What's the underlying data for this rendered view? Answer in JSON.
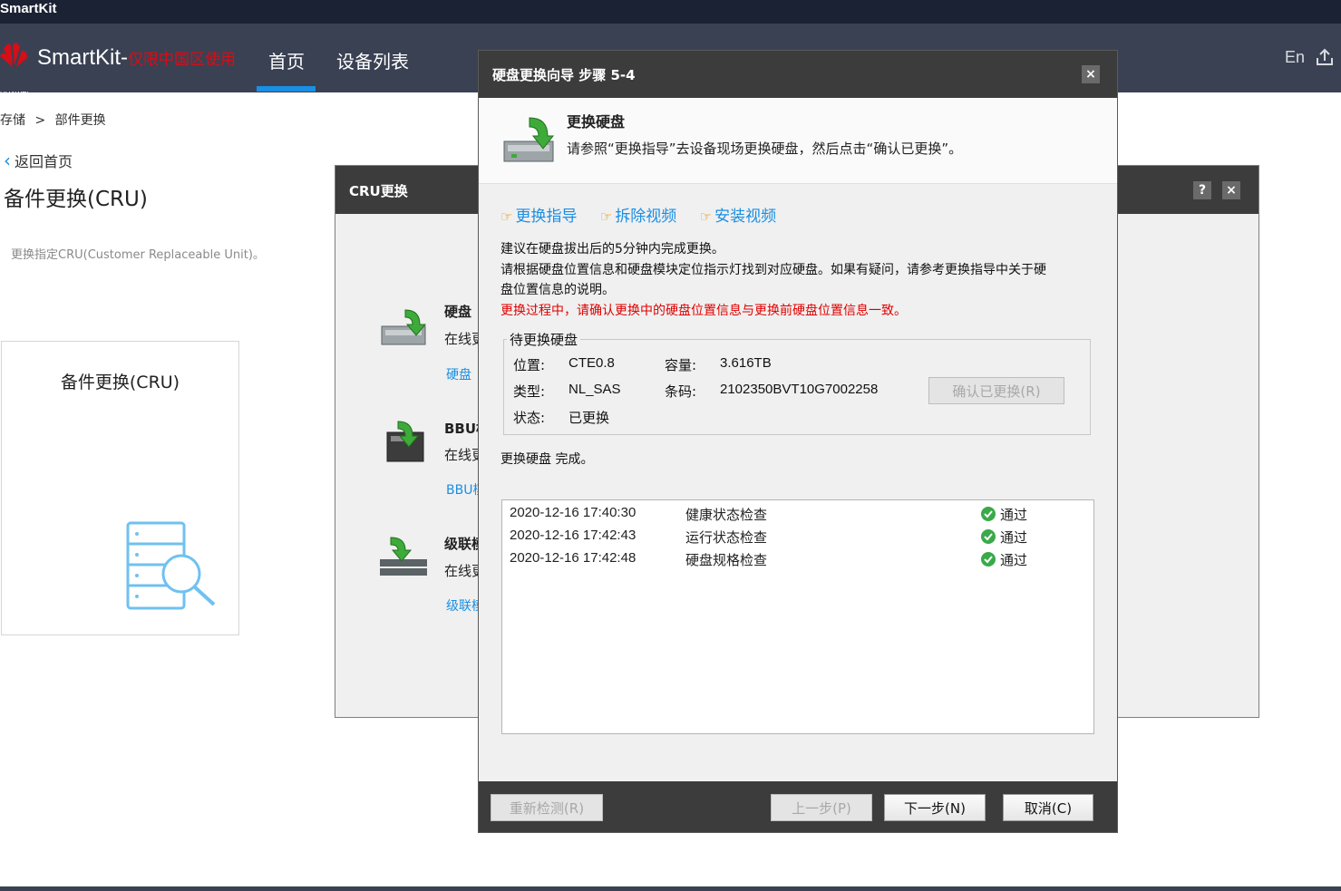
{
  "app": {
    "window_title": "SmartKit",
    "brand": "SmartKit-",
    "brand_note": "仅限中国区使用",
    "logo_text": "HUAWEI",
    "nav": [
      "首页",
      "设备列表"
    ],
    "lang": "En"
  },
  "page": {
    "breadcrumb_root": "存储",
    "breadcrumb_sep": ">",
    "breadcrumb_current": "部件更换",
    "back_label": "返回首页",
    "title": "备件更换(CRU)",
    "description": "更换指定CRU(Customer Replaceable Unit)。",
    "card_title": "备件更换(CRU)"
  },
  "cru_dialog": {
    "title": "CRU更换",
    "help": "?",
    "close": "×",
    "items": [
      {
        "name": "硬盘",
        "sub": "在线更",
        "link": "硬盘"
      },
      {
        "name": "BBU模",
        "sub": "在线更",
        "link": "BBU模"
      },
      {
        "name": "级联模",
        "sub": "在线更",
        "link": "级联模"
      }
    ]
  },
  "wizard": {
    "title": "硬盘更换向导 步骤 5-4",
    "close": "×",
    "banner_title": "更换硬盘",
    "banner_desc": "请参照“更换指导”去设备现场更换硬盘，然后点击“确认已更换”。",
    "links": [
      "更换指导",
      "拆除视频",
      "安装视频"
    ],
    "line1": "建议在硬盘拔出后的5分钟内完成更换。",
    "line2a": "请根据硬盘位置信息和硬盘模块定位指示灯找到对应硬盘。如果有疑问，请参考更换指导中关于硬",
    "line2b": "盘位置信息的说明。",
    "warning": "更换过程中，请确认更换中的硬盘位置信息与更换前硬盘位置信息一致。",
    "group_label": "待更换硬盘",
    "fields": {
      "location_label": "位置:",
      "location": "CTE0.8",
      "capacity_label": "容量:",
      "capacity": "3.616TB",
      "type_label": "类型:",
      "type": "NL_SAS",
      "barcode_label": "条码:",
      "barcode": "2102350BVT10G7002258",
      "status_label": "状态:",
      "status": "已更换"
    },
    "confirm_button": "确认已更换(R)",
    "complete_text": "更换硬盘 完成。",
    "log": [
      {
        "time": "2020-12-16 17:40:30",
        "name": "健康状态检查",
        "result": "通过"
      },
      {
        "time": "2020-12-16 17:42:43",
        "name": "运行状态检查",
        "result": "通过"
      },
      {
        "time": "2020-12-16 17:42:48",
        "name": "硬盘规格检查",
        "result": "通过"
      }
    ],
    "buttons": {
      "recheck": "重新检测(R)",
      "prev": "上一步(P)",
      "next": "下一步(N)",
      "cancel": "取消(C)"
    }
  },
  "colors": {
    "nav_bg": "#3a4153",
    "accent": "#1a8fe3",
    "warning": "#e00000",
    "brand_red": "#d50e17",
    "ok_green": "#3aa94a"
  }
}
